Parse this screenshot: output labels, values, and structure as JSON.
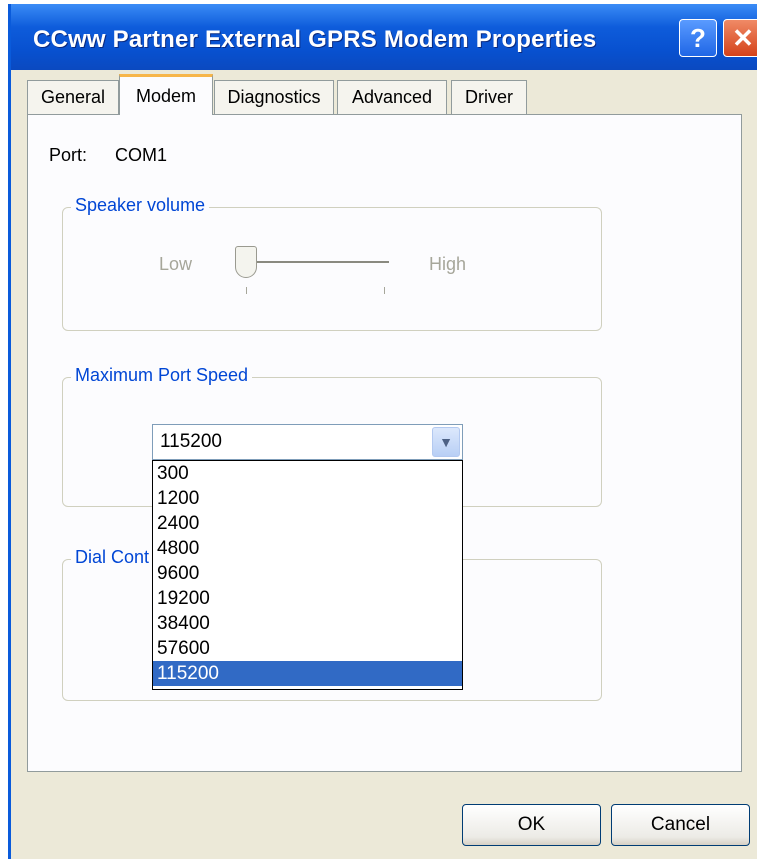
{
  "window": {
    "title": "CCww Partner External GPRS Modem Properties",
    "help_icon_glyph": "?",
    "close_icon_glyph": "✕"
  },
  "tabs": [
    {
      "label": "General",
      "active": false
    },
    {
      "label": "Modem",
      "active": true
    },
    {
      "label": "Diagnostics",
      "active": false
    },
    {
      "label": "Advanced",
      "active": false
    },
    {
      "label": "Driver",
      "active": false
    }
  ],
  "port": {
    "label": "Port:",
    "value": "COM1"
  },
  "speaker_volume": {
    "legend": "Speaker volume",
    "low_label": "Low",
    "high_label": "High",
    "level": 0
  },
  "max_port_speed": {
    "legend": "Maximum Port Speed",
    "selected": "115200",
    "options": [
      "300",
      "1200",
      "2400",
      "4800",
      "9600",
      "19200",
      "38400",
      "57600",
      "115200"
    ],
    "highlighted_option": "115200"
  },
  "dial_control": {
    "legend": "Dial Cont"
  },
  "buttons": {
    "ok": "OK",
    "cancel": "Cancel"
  },
  "colors": {
    "titlebar": "#0851d0",
    "groupbox_legend": "#0046d5",
    "selection": "#316ac5",
    "active_tab_accent": "#f7b64a"
  }
}
